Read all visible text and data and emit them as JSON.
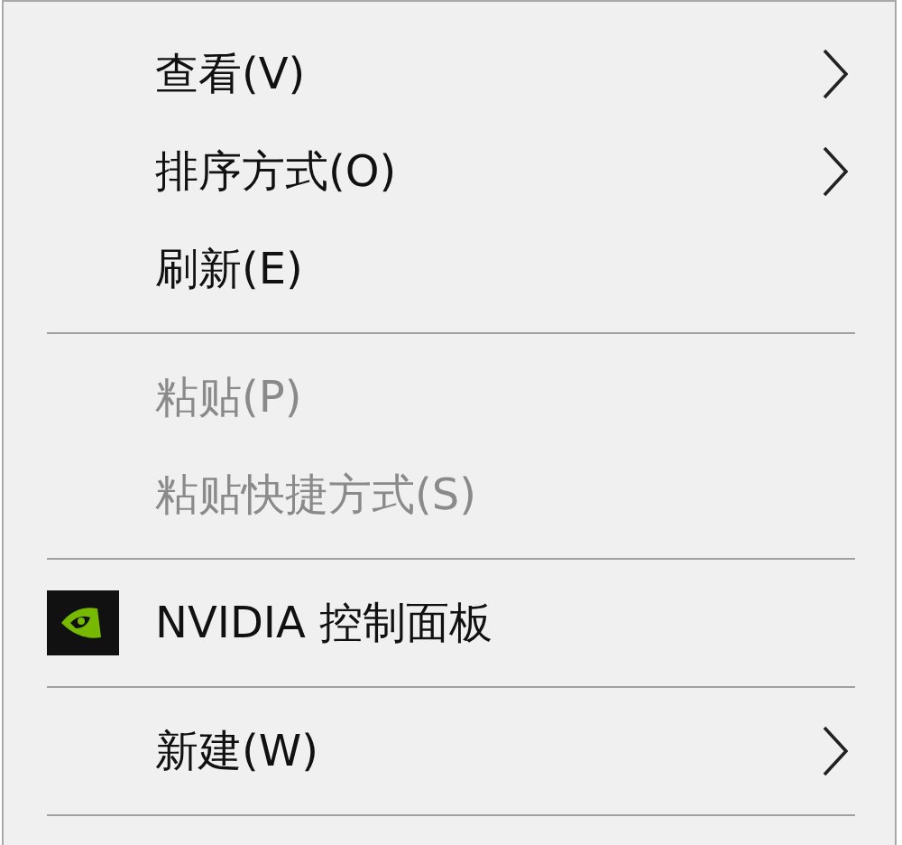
{
  "menu_items": [
    {
      "kind": "item",
      "label": "查看(V)",
      "disabled": false,
      "submenu": true,
      "has_icon": false
    },
    {
      "kind": "item",
      "label": "排序方式(O)",
      "disabled": false,
      "submenu": true,
      "has_icon": false
    },
    {
      "kind": "item",
      "label": "刷新(E)",
      "disabled": false,
      "submenu": false,
      "has_icon": false
    },
    {
      "kind": "separator"
    },
    {
      "kind": "item",
      "label": "粘贴(P)",
      "disabled": true,
      "submenu": false,
      "has_icon": false
    },
    {
      "kind": "item",
      "label": "粘贴快捷方式(S)",
      "disabled": true,
      "submenu": false,
      "has_icon": false
    },
    {
      "kind": "separator"
    },
    {
      "kind": "item",
      "label": "NVIDIA 控制面板",
      "disabled": false,
      "submenu": false,
      "has_icon": true
    },
    {
      "kind": "separator"
    },
    {
      "kind": "item",
      "label": "新建(W)",
      "disabled": false,
      "submenu": true,
      "has_icon": false
    },
    {
      "kind": "separator"
    }
  ]
}
